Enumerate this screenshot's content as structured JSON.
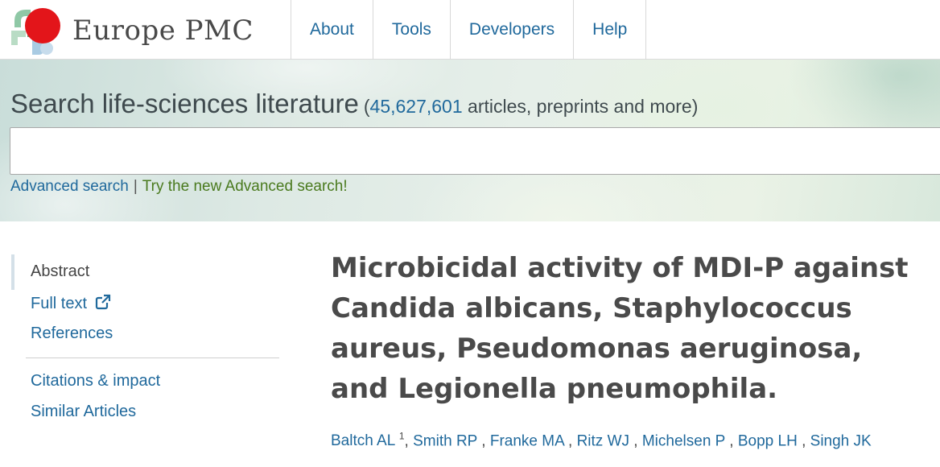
{
  "header": {
    "logo_text": "Europe PMC",
    "nav": [
      {
        "label": "About"
      },
      {
        "label": "Tools"
      },
      {
        "label": "Developers"
      },
      {
        "label": "Help"
      }
    ]
  },
  "search": {
    "title": "Search life-sciences literature",
    "count_open": "(",
    "count": "45,627,601",
    "count_suffix": " articles, preprints and more)",
    "input_value": "",
    "advanced_link": "Advanced search",
    "separator": "|",
    "new_advanced_link": "Try the new Advanced search!"
  },
  "sidebar": {
    "items": [
      {
        "label": "Abstract"
      },
      {
        "label": "Full text"
      },
      {
        "label": "References"
      },
      {
        "label": "Citations & impact"
      },
      {
        "label": "Similar Articles"
      }
    ]
  },
  "article": {
    "title": "Microbicidal activity of MDI-P against Candida albicans, Staphylococcus aureus, Pseudomonas aeruginosa, and Legionella pneumophila.",
    "authors": [
      {
        "name": "Baltch AL",
        "sup": "1"
      },
      {
        "name": "Smith RP"
      },
      {
        "name": "Franke MA"
      },
      {
        "name": "Ritz WJ"
      },
      {
        "name": "Michelsen P"
      },
      {
        "name": "Bopp LH"
      },
      {
        "name": "Singh JK"
      }
    ]
  },
  "colors": {
    "link_blue": "#20699c",
    "link_green": "#4a7a1e",
    "logo_red": "#e3151a"
  },
  "icons": {
    "logo": "europe-pmc-logo-icon",
    "external": "external-link-icon"
  }
}
